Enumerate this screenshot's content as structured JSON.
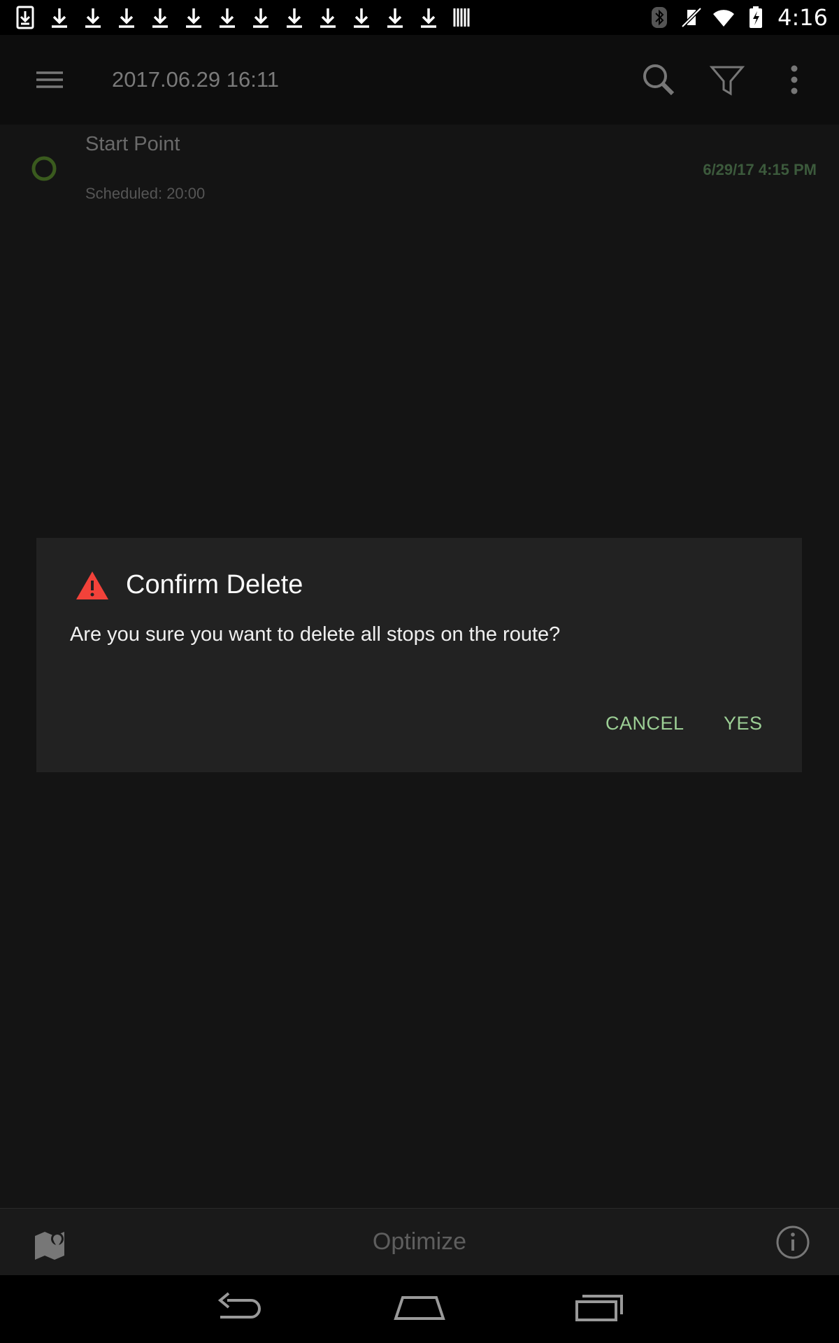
{
  "status_bar": {
    "time": "4:16",
    "notification_icons": [
      "download-box-icon",
      "download-icon",
      "download-icon",
      "download-icon",
      "download-icon",
      "download-icon",
      "download-icon",
      "download-icon",
      "download-icon",
      "download-icon",
      "download-icon",
      "download-icon",
      "download-icon",
      "barcode-icon"
    ],
    "system_icons": [
      "bluetooth-icon",
      "vibrate-mute-icon",
      "wifi-icon",
      "battery-charging-icon"
    ]
  },
  "app_bar": {
    "title": "2017.06.29 16:11",
    "icons": [
      "menu-icon",
      "search-icon",
      "filter-icon",
      "more-vert-icon"
    ]
  },
  "stop": {
    "title": "Start Point",
    "scheduled": "Scheduled: 20:00",
    "time": "6/29/17 4:15 PM",
    "dot_color": "#3a5a1e"
  },
  "dialog": {
    "title": "Confirm Delete",
    "message": "Are you sure you want to delete all stops on the route?",
    "cancel_label": "CANCEL",
    "yes_label": "YES",
    "accent_color": "#9ccf95",
    "warning_color": "#f2423a"
  },
  "bottom_bar": {
    "optimize_label": "Optimize",
    "icons": [
      "map-pin-icon",
      "info-icon"
    ]
  },
  "nav_bar": {
    "icons": [
      "back-icon",
      "home-icon",
      "recents-icon"
    ]
  }
}
